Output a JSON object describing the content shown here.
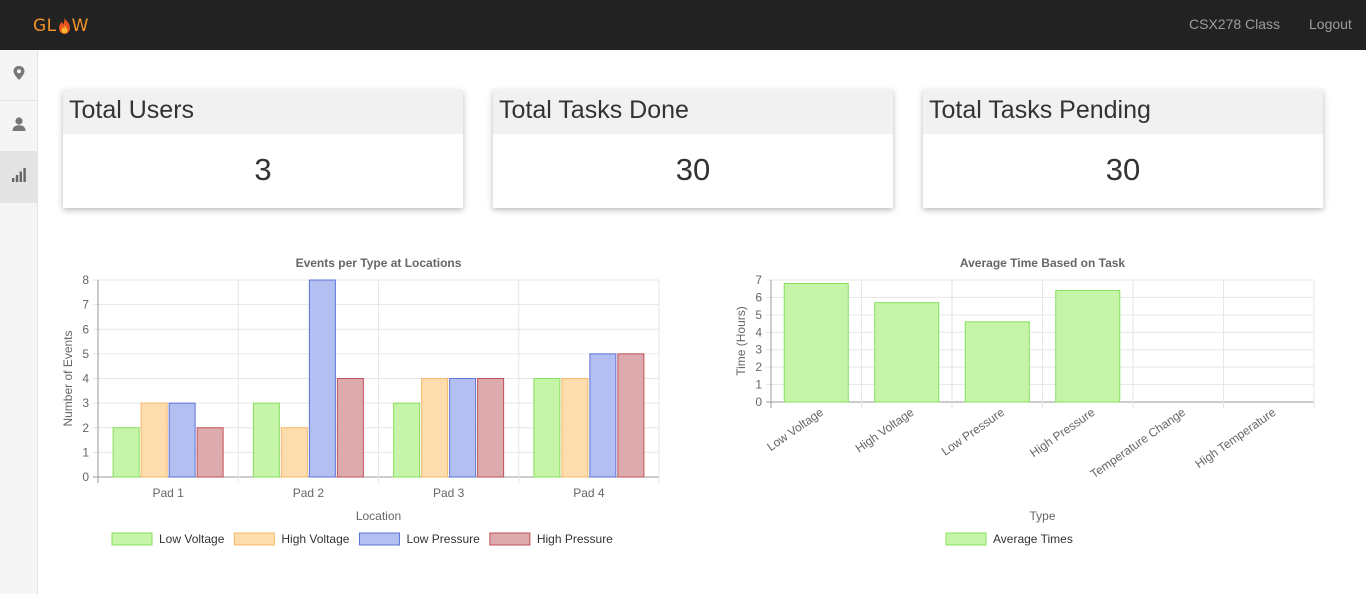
{
  "navbar": {
    "brand_left": "GL",
    "brand_right": "W",
    "brand_icon": "flame-icon",
    "links": [
      "CSX278 Class",
      "Logout"
    ]
  },
  "sidebar": {
    "items": [
      {
        "icon": "map-marker-icon",
        "active": false
      },
      {
        "icon": "user-icon",
        "active": false
      },
      {
        "icon": "signal-bars-icon",
        "active": true
      }
    ]
  },
  "cards": [
    {
      "title": "Total Users",
      "value": "3"
    },
    {
      "title": "Total Tasks Done",
      "value": "30"
    },
    {
      "title": "Total Tasks Pending",
      "value": "30"
    }
  ],
  "chart_data": [
    {
      "type": "bar",
      "title": "Events per Type at Locations",
      "xlabel": "Location",
      "ylabel": "Number of Events",
      "ylim": [
        0,
        8
      ],
      "yticks": [
        "0",
        "1",
        "2",
        "3",
        "4",
        "5",
        "6",
        "7",
        "8"
      ],
      "categories": [
        "Pad 1",
        "Pad 2",
        "Pad 3",
        "Pad 4"
      ],
      "series": [
        {
          "name": "Low Voltage",
          "values": [
            2,
            3,
            3,
            4
          ],
          "fill": "#c6f5a9",
          "stroke": "#85e05c"
        },
        {
          "name": "High Voltage",
          "values": [
            3,
            2,
            4,
            4
          ],
          "fill": "#fddcae",
          "stroke": "#f5b967"
        },
        {
          "name": "Low Pressure",
          "values": [
            3,
            8,
            4,
            5
          ],
          "fill": "#b3bff0",
          "stroke": "#5c73d9"
        },
        {
          "name": "High Pressure",
          "values": [
            2,
            4,
            4,
            5
          ],
          "fill": "#ddabad",
          "stroke": "#c05057"
        }
      ],
      "grid": true,
      "legend": "bottom"
    },
    {
      "type": "bar",
      "title": "Average Time Based on Task",
      "xlabel": "Type",
      "ylabel": "Time (Hours)",
      "ylim": [
        0,
        7
      ],
      "yticks": [
        "0",
        "1",
        "2",
        "3",
        "4",
        "5",
        "6",
        "7"
      ],
      "categories": [
        "Low Voltage",
        "High Voltage",
        "Low Pressure",
        "High Pressure",
        "Temperature Change",
        "High Temperature"
      ],
      "series": [
        {
          "name": "Average Times",
          "values": [
            6.8,
            5.7,
            4.6,
            6.4,
            0,
            0
          ],
          "fill": "#c6f5a9",
          "stroke": "#85e05c"
        }
      ],
      "grid": true,
      "legend": "bottom"
    }
  ]
}
